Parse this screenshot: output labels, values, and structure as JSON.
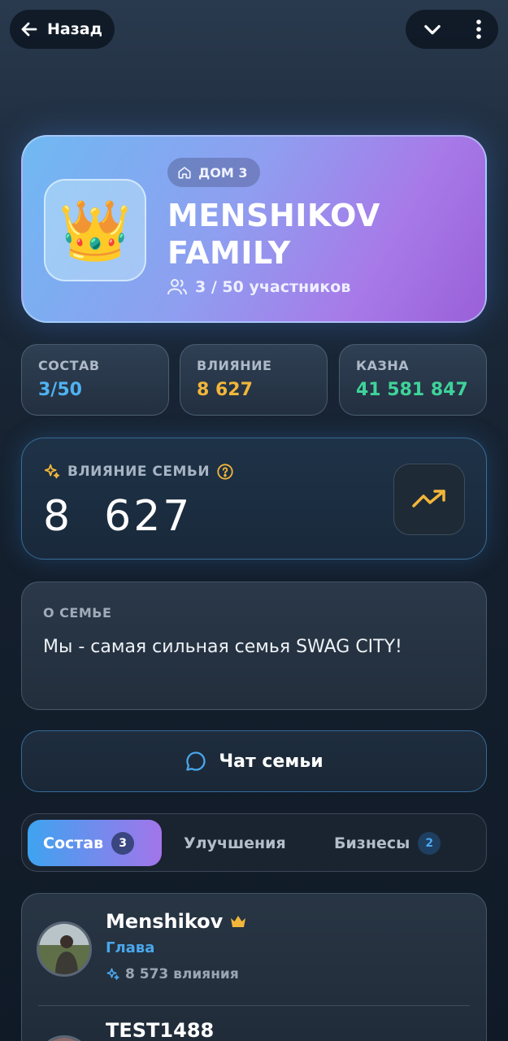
{
  "header": {
    "back_label": "Назад",
    "back_icon": "arrow-left-icon",
    "menu_icons": [
      "chevron-down-icon",
      "more-vertical-icon"
    ]
  },
  "family": {
    "emblem": "👑",
    "house_label": "ДОМ 3",
    "name": "MENSHIKOV FAMILY",
    "members_text": "3 / 50 участников"
  },
  "stats": [
    {
      "label": "СОСТАВ",
      "value": "3/50",
      "color": "#4fb3f2"
    },
    {
      "label": "ВЛИЯНИЕ",
      "value": "8 627",
      "color": "#f2b63a"
    },
    {
      "label": "КАЗНА",
      "value": "41 581 847",
      "color": "#3fd39a"
    }
  ],
  "influence": {
    "label": "ВЛИЯНИЕ СЕМЬИ",
    "value": "8  627",
    "accent": "#f2b63a"
  },
  "about": {
    "label": "О СЕМЬЕ",
    "text": "Мы - самая сильная семья SWAG CITY!"
  },
  "chat": {
    "label": "Чат семьи"
  },
  "tabs": [
    {
      "label": "Состав",
      "count": "3",
      "active": true
    },
    {
      "label": "Улучшения",
      "count": "",
      "active": false
    },
    {
      "label": "Бизнесы",
      "count": "2",
      "active": false
    }
  ],
  "members": [
    {
      "name": "Menshikov",
      "role": "Глава",
      "influence": "8 573 влияния"
    },
    {
      "name": "TEST1488",
      "role": "",
      "influence": ""
    }
  ]
}
